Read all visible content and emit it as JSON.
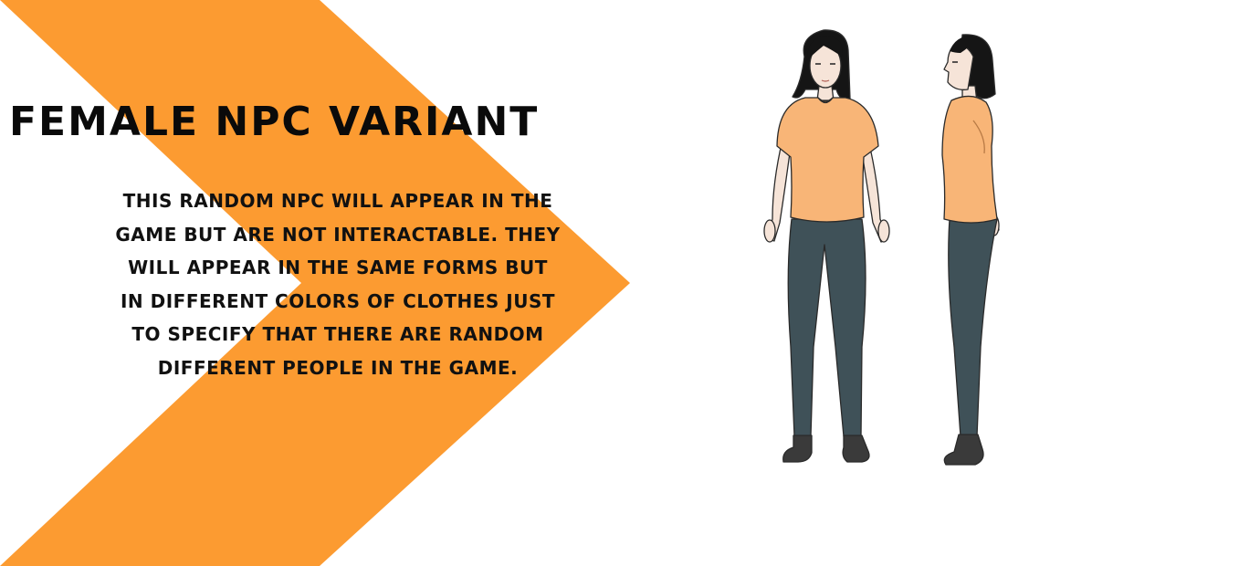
{
  "colors": {
    "accent": "#FC9B31",
    "shirt": "#F8B577",
    "pants": "#3F5158",
    "hair": "#151515",
    "skin": "#F6E4D8"
  },
  "page": {
    "title": "FEMALE NPC VARIANT",
    "description_lines": [
      "THIS RANDOM NPC WILL APPEAR IN THE",
      "GAME BUT ARE NOT INTERACTABLE. THEY",
      "WILL APPEAR IN THE SAME FORMS BUT",
      "IN DIFFERENT COLORS OF CLOTHES JUST",
      "TO SPECIFY THAT THERE ARE RANDOM",
      "DIFFERENT PEOPLE IN THE GAME."
    ]
  },
  "figures": {
    "front_view": "female-npc-front-view",
    "side_view": "female-npc-side-view"
  }
}
